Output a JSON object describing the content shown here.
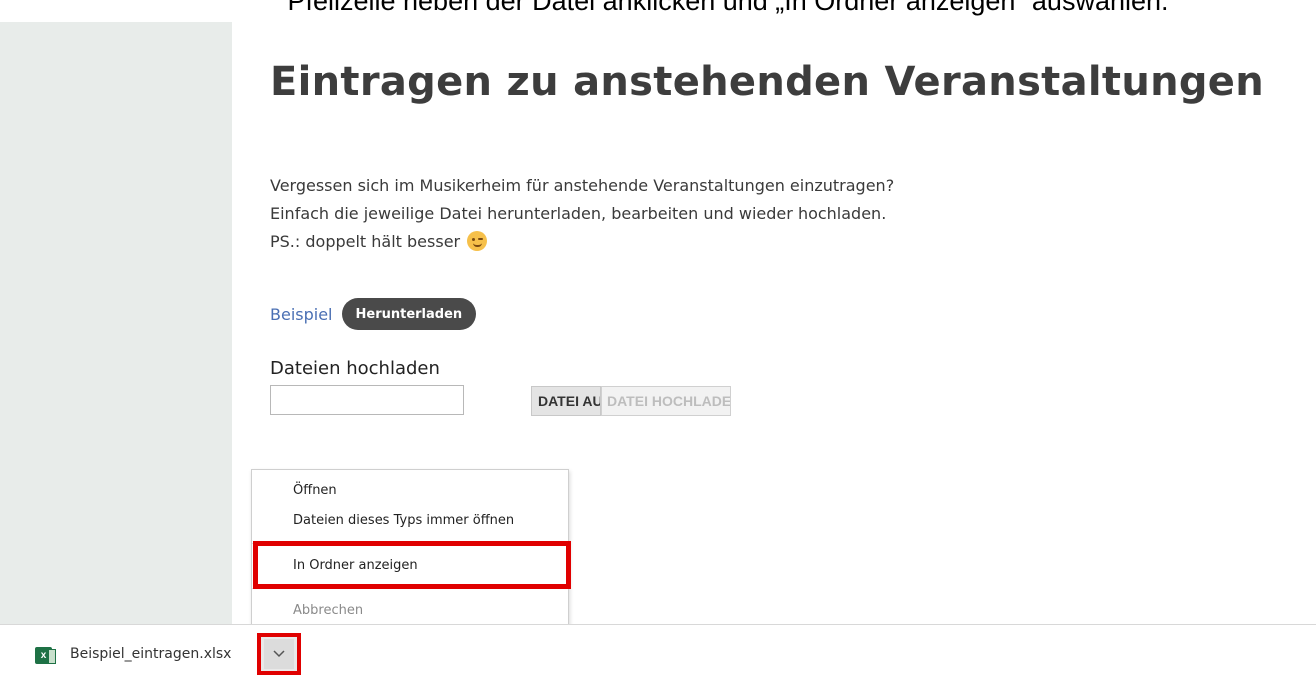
{
  "caption": "Pfeilzeile neben der Datei anklicken und „In Ordner anzeigen“ auswählen.",
  "page": {
    "title": "Eintragen zu anstehenden Veranstaltungen",
    "intro_lines": [
      "Vergessen sich im Musikerheim für anstehende Veranstaltungen einzutragen?",
      "Einfach die jeweilige Datei herunterladen, bearbeiten und wieder hochladen.",
      "PS.: doppelt hält besser"
    ],
    "example_link": "Beispiel",
    "download_button": "Herunterladen",
    "upload_label": "Dateien hochladen",
    "choose_button": "DATEI AUSWÄHLEN",
    "upload_button": "DATEI HOCHLADEN"
  },
  "context_menu": {
    "items": [
      {
        "label": "Öffnen",
        "enabled": true
      },
      {
        "label": "Dateien dieses Typs immer öffnen",
        "enabled": true
      },
      {
        "label": "In Ordner anzeigen",
        "enabled": true,
        "highlighted": true
      },
      {
        "label": "Abbrechen",
        "enabled": false
      }
    ]
  },
  "download_bar": {
    "file_name": "Beispiel_eintragen.xlsx",
    "file_icon": "excel-file-icon",
    "menu_icon": "chevron-down-icon"
  },
  "colors": {
    "highlight": "#e00000",
    "link": "#4a6fb3",
    "button_bg": "#4a4a4a",
    "sidebar_bg": "#e8ecea"
  }
}
